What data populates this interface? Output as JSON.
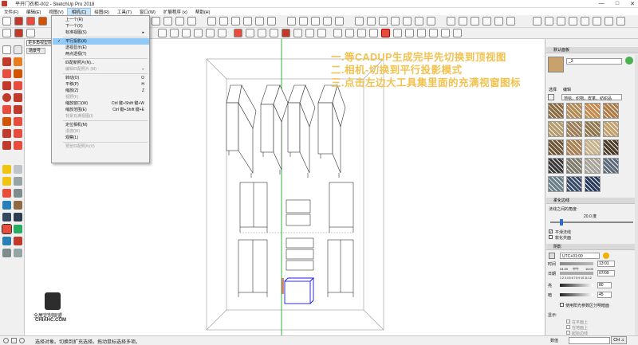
{
  "window": {
    "title": "平开门衣柜-002 - SketchUp Pro 2018",
    "controls": [
      "minimize-icon",
      "maximize-icon",
      "close-icon"
    ]
  },
  "menubar": {
    "items": [
      {
        "label": "文件(F)"
      },
      {
        "label": "编辑(E)"
      },
      {
        "label": "视图(V)"
      },
      {
        "label": "相机(C)",
        "active": true
      },
      {
        "label": "绘图(R)"
      },
      {
        "label": "工具(T)"
      },
      {
        "label": "窗口(W)"
      },
      {
        "label": "扩展程序 (x)"
      },
      {
        "label": "帮助(H)"
      }
    ]
  },
  "camera_menu": {
    "items": [
      {
        "label": "上一个(R)",
        "shortcut": "",
        "disabled": false
      },
      {
        "label": "下一个(X)",
        "shortcut": "",
        "disabled": false
      },
      {
        "label": "标准视图(S)",
        "shortcut": "",
        "disabled": false,
        "submenu": true
      },
      {
        "sep": true
      },
      {
        "label": "平行投影(A)",
        "shortcut": "",
        "checked": true,
        "highlighted": true
      },
      {
        "label": "透视显示(E)",
        "shortcut": ""
      },
      {
        "label": "两点透视(T)",
        "shortcut": ""
      },
      {
        "sep": true
      },
      {
        "label": "匹配新照片(N)...",
        "shortcut": ""
      },
      {
        "label": "编辑匹配照片 (M)",
        "shortcut": "",
        "disabled": true,
        "submenu": true
      },
      {
        "sep": true
      },
      {
        "label": "转动(O)",
        "shortcut": "O"
      },
      {
        "label": "平移(P)",
        "shortcut": "H"
      },
      {
        "label": "缩放(Z)",
        "shortcut": "Z"
      },
      {
        "label": "视野(F)",
        "shortcut": "",
        "disabled": true
      },
      {
        "label": "缩放窗口(W)",
        "shortcut": "Ctrl 键+Shift 键+W"
      },
      {
        "label": "缩放范围(E)",
        "shortcut": "Ctrl 键+Shift 键+E"
      },
      {
        "label": "背景充满视图(I)",
        "shortcut": "",
        "disabled": true
      },
      {
        "sep": true
      },
      {
        "label": "定位相机(M)",
        "shortcut": ""
      },
      {
        "label": "漫游(W)",
        "shortcut": "",
        "disabled": true
      },
      {
        "label": "观察(L)",
        "shortcut": ""
      },
      {
        "sep": true
      },
      {
        "label": "预览匹配照片(V)",
        "shortcut": "",
        "disabled": true
      }
    ]
  },
  "tooltip": "更多角视型层",
  "scene_tab": "场景号",
  "annotation": {
    "line1": "一.等CADUP生成完毕先切换到顶视图",
    "line2": "二.相机-切换到平行投影模式",
    "line3": "三.点击左边大工具集里面的充满视窗图标"
  },
  "watermark": {
    "text": "全屋定制联盟",
    "sub": "CHIAHC.COM"
  },
  "right_panel": {
    "default_tray": "默认面板",
    "material_title": "_3",
    "tabs": [
      "选择",
      "编辑"
    ],
    "material_dropdown": "地毯，织物，皮革，纺织品",
    "soften_header": "柔化边线",
    "normal_angle_label": "法线之间的角度:",
    "normal_angle_value": "20.0 度",
    "smooth_normals": "平滑法线",
    "soften_coplanar": "软化共面",
    "shadow_header": "阴影",
    "timezone": "UTC+01:00",
    "time_label": "时间",
    "time_value": "13:01",
    "time_ticks": [
      "04:39",
      "中午",
      "16:00"
    ],
    "date_label": "日期",
    "date_value": "07/09",
    "month_ticks": "1 2 3 4 5 6 7 8 9 10 11 12",
    "light_label": "亮",
    "light_value": "80",
    "dark_label": "暗",
    "dark_value": "45",
    "sun_shading": "使用阳光参数区分明暗面",
    "display_label": "显示:",
    "on_faces": "在平面上",
    "on_ground": "在地面上",
    "from_edges": "起始边线"
  },
  "status": {
    "message": "选择对象。切换到扩充选择。拖动鼠标选择多项。",
    "measure_label": "数值",
    "lang_badge": "CH ♫"
  },
  "colors": {
    "menu_highlight": "#91c9f7",
    "annotation": "#f2c14e",
    "selection_blue": "#1a1ad6",
    "axis_green": "#00a000"
  },
  "swatch_colors": [
    "#8a6a3e",
    "#b58a52",
    "#c68a4a",
    "#b07a42",
    "#b59a6a",
    "#9d7a52",
    "#8f7548",
    "#c4a06a",
    "#6f5434",
    "#a87e4c",
    "#c9b28a",
    "#4a3a26",
    "#3a3a3a",
    "#7e7a6a",
    "#a9a49a",
    "#5a6a7a",
    "#6a7e8a",
    "#3a4a6a",
    "#2a3a5e"
  ]
}
